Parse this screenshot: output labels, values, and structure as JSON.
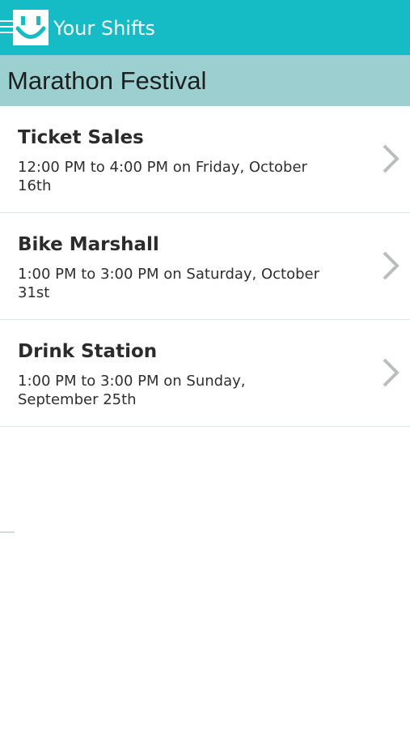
{
  "app_bar": {
    "title": "Your Shifts",
    "menu_icon": "hamburger-menu-icon",
    "logo_icon": "smiley-logo-icon",
    "background_color": "#15bcc6"
  },
  "event": {
    "title": "Marathon Festival",
    "header_color": "#9ccfcf"
  },
  "shifts": [
    {
      "name": "Ticket Sales",
      "time": "12:00 PM to 4:00 PM on Friday, October 16th"
    },
    {
      "name": "Bike Marshall",
      "time": "1:00 PM to 3:00 PM on Saturday, October 31st"
    },
    {
      "name": "Drink Station",
      "time": "1:00 PM to 3:00 PM on Sunday, September 25th"
    }
  ],
  "row_icon": "chevron-right-icon"
}
